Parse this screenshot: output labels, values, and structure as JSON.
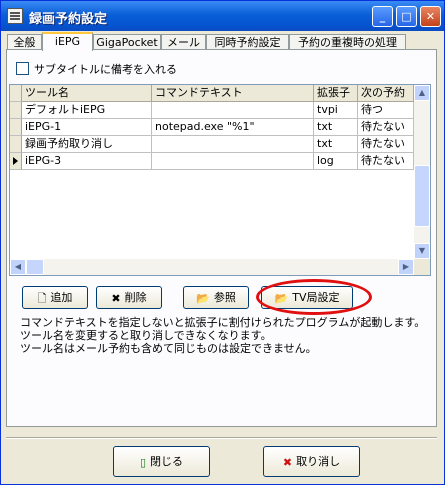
{
  "window": {
    "title": "録画予約設定"
  },
  "tabs": [
    "全般",
    "iEPG",
    "GigaPocket",
    "メール",
    "同時予約設定",
    "予約の重複時の処理"
  ],
  "active_tab": "iEPG",
  "checkbox": {
    "label": "サブタイトルに備考を入れる",
    "checked": false
  },
  "grid": {
    "columns": [
      "ツール名",
      "コマンドテキスト",
      "拡張子",
      "次の予約"
    ],
    "rows": [
      {
        "name": "デフォルトiEPG",
        "command": "",
        "ext": "tvpi",
        "next": "待つ"
      },
      {
        "name": "iEPG-1",
        "command": "notepad.exe \"%1\"",
        "ext": "txt",
        "next": "待たない"
      },
      {
        "name": "録画予約取り消し",
        "command": "",
        "ext": "txt",
        "next": "待たない"
      },
      {
        "name": "iEPG-3",
        "command": "",
        "ext": "log",
        "next": "待たない"
      }
    ]
  },
  "buttons": {
    "add": "追加",
    "delete": "削除",
    "browse": "参照",
    "tv_station": "TV局設定",
    "close": "閉じる",
    "cancel": "取り消し"
  },
  "description": [
    "コマンドテキストを指定しないと拡張子に割付けられたプログラムが起動します。",
    "ツール名を変更すると取り消しできなくなります。",
    "ツール名はメール予約も含めて同じものは設定できません。"
  ],
  "accent_colors": {
    "titlebar": "#0553d0",
    "highlight_oval": "#e01010",
    "active_tab": "#ffc83c"
  }
}
